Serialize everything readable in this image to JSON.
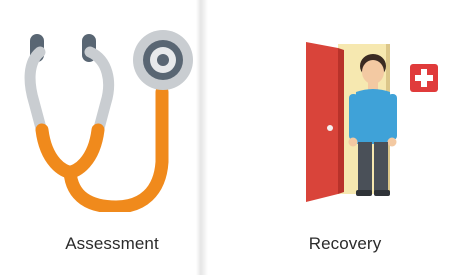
{
  "cards": [
    {
      "label": "Assessment",
      "icon": "stethoscope-icon"
    },
    {
      "label": "Recovery",
      "icon": "patient-leaving-door-icon"
    }
  ],
  "colors": {
    "stethoscope_orange": "#f08a1c",
    "stethoscope_gray": "#c9cdd1",
    "stethoscope_earpiece": "#596673",
    "door_red": "#d9443a",
    "door_light": "#f6e8b0",
    "shirt_blue": "#3fa2d8",
    "cross_badge_red": "#e03b3b"
  }
}
